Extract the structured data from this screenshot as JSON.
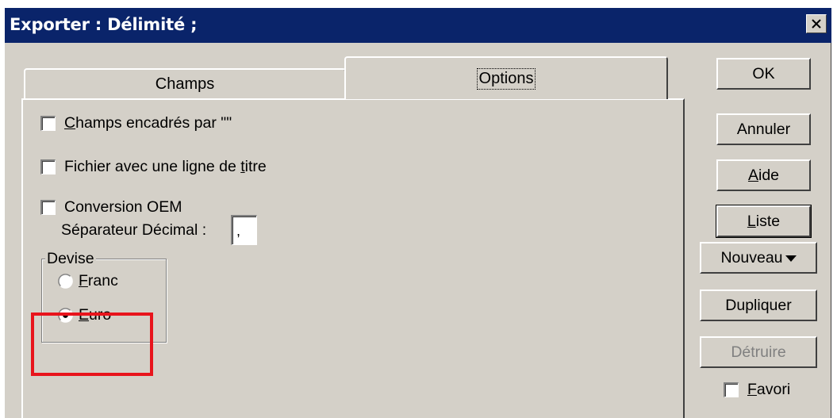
{
  "window": {
    "title": "Exporter : Délimité ;",
    "close_label": "Close"
  },
  "tabs": [
    {
      "label": "Champs",
      "active": false
    },
    {
      "label": "Options",
      "active": true
    }
  ],
  "options": {
    "checkboxes": [
      {
        "pre": "",
        "ul": "C",
        "post": "hamps encadrés par \"\"",
        "checked": false
      },
      {
        "pre": "Fichier avec une ligne de ",
        "ul": "t",
        "post": "itre",
        "checked": false
      },
      {
        "pre": "Conversion OEM",
        "ul": "",
        "post": "",
        "checked": false
      }
    ],
    "separator": {
      "label": "Séparateur Décimal :",
      "value": ","
    },
    "devise": {
      "legend": "Devise",
      "options": [
        {
          "ul": "F",
          "post": "ranc",
          "selected": false
        },
        {
          "ul": "E",
          "post": "uro",
          "selected": true
        }
      ]
    }
  },
  "buttons": {
    "ok": "OK",
    "annuler": "Annuler",
    "aide_ul": "A",
    "aide_post": "ide",
    "liste_ul": "L",
    "liste_post": "iste",
    "nouveau": "Nouveau",
    "dupliquer": "Dupliquer",
    "detruire": "Détruire"
  },
  "favori": {
    "ul": "F",
    "post": "avori",
    "checked": false
  },
  "colors": {
    "titlebar": "#0a246a",
    "dialog_face": "#d4d0c8",
    "highlight": "#e8141c"
  }
}
